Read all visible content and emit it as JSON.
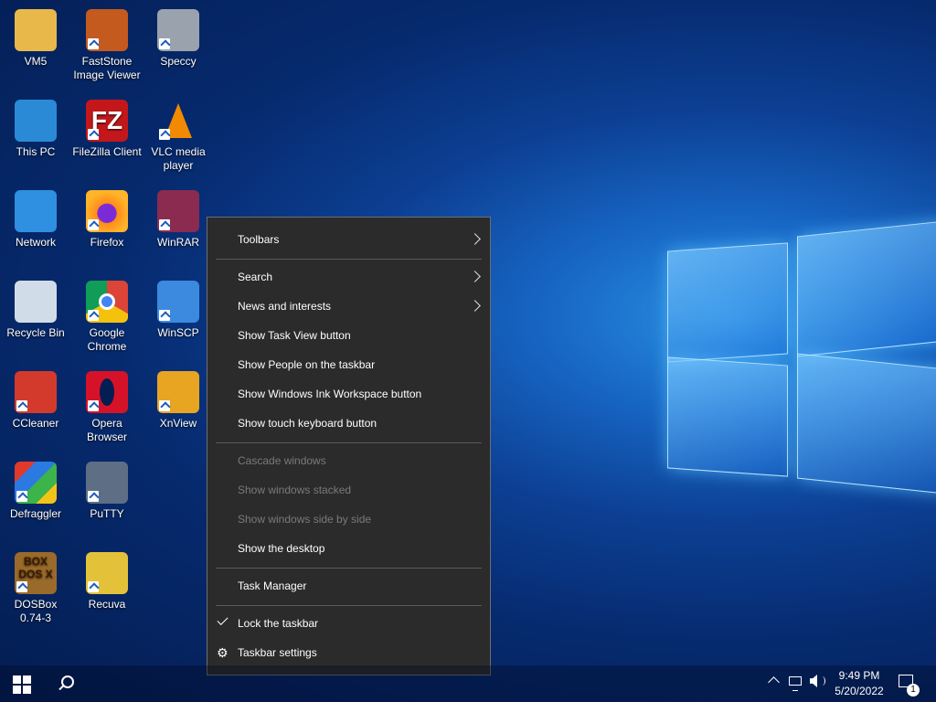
{
  "desktop": {
    "icons": [
      {
        "label": "VM5",
        "icon": "folder-user-icon"
      },
      {
        "label": "FastStone Image Viewer",
        "icon": "faststone-icon"
      },
      {
        "label": "Speccy",
        "icon": "speccy-icon"
      },
      {
        "label": "This PC",
        "icon": "computer-icon"
      },
      {
        "label": "FileZilla Client",
        "icon": "filezilla-icon"
      },
      {
        "label": "VLC media player",
        "icon": "vlc-icon"
      },
      {
        "label": "Network",
        "icon": "network-icon"
      },
      {
        "label": "Firefox",
        "icon": "firefox-icon"
      },
      {
        "label": "WinRAR",
        "icon": "winrar-icon"
      },
      {
        "label": "Recycle Bin",
        "icon": "recycle-bin-icon"
      },
      {
        "label": "Google Chrome",
        "icon": "chrome-icon"
      },
      {
        "label": "WinSCP",
        "icon": "winscp-icon"
      },
      {
        "label": "CCleaner",
        "icon": "ccleaner-icon"
      },
      {
        "label": "Opera Browser",
        "icon": "opera-icon"
      },
      {
        "label": "XnView",
        "icon": "xnview-icon"
      },
      {
        "label": "Defraggler",
        "icon": "defraggler-icon"
      },
      {
        "label": "PuTTY",
        "icon": "putty-icon"
      },
      {
        "label": "DOSBox 0.74-3",
        "icon": "dosbox-icon"
      },
      {
        "label": "Recuva",
        "icon": "recuva-icon"
      }
    ],
    "dosbox_logo_text": "BOX DOS X",
    "filezilla_logo_text": "FZ"
  },
  "context_menu": {
    "items": [
      {
        "label": "Toolbars",
        "submenu": true,
        "enabled": true
      },
      {
        "label": "Search",
        "submenu": true,
        "enabled": true
      },
      {
        "label": "News and interests",
        "submenu": true,
        "enabled": true
      },
      {
        "label": "Show Task View button",
        "enabled": true
      },
      {
        "label": "Show People on the taskbar",
        "enabled": true
      },
      {
        "label": "Show Windows Ink Workspace button",
        "enabled": true
      },
      {
        "label": "Show touch keyboard button",
        "enabled": true
      },
      {
        "label": "Cascade windows",
        "enabled": false
      },
      {
        "label": "Show windows stacked",
        "enabled": false
      },
      {
        "label": "Show windows side by side",
        "enabled": false
      },
      {
        "label": "Show the desktop",
        "enabled": true
      },
      {
        "label": "Task Manager",
        "enabled": true
      },
      {
        "label": "Lock the taskbar",
        "checked": true,
        "enabled": true
      },
      {
        "label": "Taskbar settings",
        "icon": "gear-icon",
        "enabled": true
      }
    ]
  },
  "taskbar": {
    "clock_time": "9:49 PM",
    "clock_date": "5/20/2022",
    "notification_count": "1"
  },
  "colors": {
    "menu_bg": "#2b2b2b",
    "disabled_text": "#7a7a7a",
    "accent": "#1766c4"
  }
}
